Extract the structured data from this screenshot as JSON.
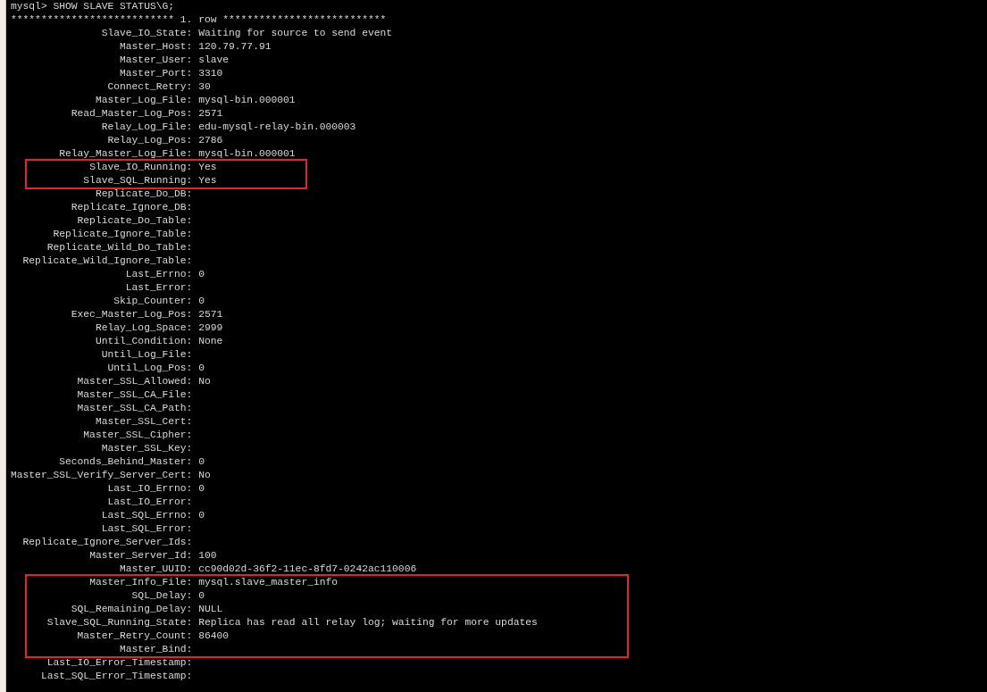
{
  "terminal": {
    "command": "mysql> SHOW SLAVE STATUS\\G;",
    "row_header": "*************************** 1. row ***************************",
    "blocks": [
      {
        "kind": "plain",
        "fields": [
          {
            "label": "Slave_IO_State:",
            "value": "Waiting for source to send event"
          },
          {
            "label": "Master_Host:",
            "value": "120.79.77.91"
          },
          {
            "label": "Master_User:",
            "value": "slave"
          },
          {
            "label": "Master_Port:",
            "value": "3310"
          },
          {
            "label": "Connect_Retry:",
            "value": "30"
          },
          {
            "label": "Master_Log_File:",
            "value": "mysql-bin.000001"
          },
          {
            "label": "Read_Master_Log_Pos:",
            "value": "2571"
          },
          {
            "label": "Relay_Log_File:",
            "value": "edu-mysql-relay-bin.000003"
          },
          {
            "label": "Relay_Log_Pos:",
            "value": "2786"
          },
          {
            "label": "Relay_Master_Log_File:",
            "value": "mysql-bin.000001"
          }
        ]
      },
      {
        "kind": "boxed",
        "fields": [
          {
            "label": "Slave_IO_Running:",
            "value": "Yes"
          },
          {
            "label": "Slave_SQL_Running:",
            "value": "Yes"
          }
        ]
      },
      {
        "kind": "plain",
        "fields": [
          {
            "label": "Replicate_Do_DB:"
          },
          {
            "label": "Replicate_Ignore_DB:"
          },
          {
            "label": "Replicate_Do_Table:"
          },
          {
            "label": "Replicate_Ignore_Table:"
          },
          {
            "label": "Replicate_Wild_Do_Table:"
          },
          {
            "label": "Replicate_Wild_Ignore_Table:"
          },
          {
            "label": "Last_Errno:",
            "value": "0"
          },
          {
            "label": "Last_Error:"
          },
          {
            "label": "Skip_Counter:",
            "value": "0"
          },
          {
            "label": "Exec_Master_Log_Pos:",
            "value": "2571"
          },
          {
            "label": "Relay_Log_Space:",
            "value": "2999"
          },
          {
            "label": "Until_Condition:",
            "value": "None"
          },
          {
            "label": "Until_Log_File:"
          },
          {
            "label": "Until_Log_Pos:",
            "value": "0"
          },
          {
            "label": "Master_SSL_Allowed:",
            "value": "No"
          },
          {
            "label": "Master_SSL_CA_File:"
          },
          {
            "label": "Master_SSL_CA_Path:"
          },
          {
            "label": "Master_SSL_Cert:"
          },
          {
            "label": "Master_SSL_Cipher:"
          },
          {
            "label": "Master_SSL_Key:"
          },
          {
            "label": "Seconds_Behind_Master:",
            "value": "0"
          },
          {
            "label": "Master_SSL_Verify_Server_Cert:",
            "value": "No"
          },
          {
            "label": "Last_IO_Errno:",
            "value": "0"
          },
          {
            "label": "Last_IO_Error:"
          },
          {
            "label": "Last_SQL_Errno:",
            "value": "0"
          },
          {
            "label": "Last_SQL_Error:"
          },
          {
            "label": "Replicate_Ignore_Server_Ids:"
          },
          {
            "label": "Master_Server_Id:",
            "value": "100"
          },
          {
            "label": "Master_UUID:",
            "value": "cc90d02d-36f2-11ec-8fd7-0242ac110006"
          }
        ]
      },
      {
        "kind": "boxed",
        "fields": [
          {
            "label": "Master_Info_File:",
            "value": "mysql.slave_master_info"
          },
          {
            "label": "SQL_Delay:",
            "value": "0"
          },
          {
            "label": "SQL_Remaining_Delay:",
            "value": "NULL"
          },
          {
            "label": "Slave_SQL_Running_State:",
            "value": "Replica has read all relay log; waiting for more updates"
          },
          {
            "label": "Master_Retry_Count:",
            "value": "86400"
          },
          {
            "label": "Master_Bind:"
          }
        ]
      },
      {
        "kind": "plain",
        "fields": [
          {
            "label": "Last_IO_Error_Timestamp:"
          },
          {
            "label": "Last_SQL_Error_Timestamp:"
          }
        ]
      }
    ]
  }
}
